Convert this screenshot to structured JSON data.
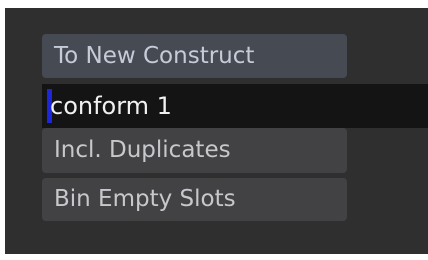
{
  "actions": {
    "to_new_construct_label": "To New Construct",
    "incl_duplicates_label": "Incl. Duplicates",
    "bin_empty_slots_label": "Bin Empty Slots"
  },
  "name_field": {
    "value": "conform 1"
  },
  "colors": {
    "panel_background": "#2f2f30",
    "button_background": "#424244",
    "primary_button_background": "#464a52",
    "field_background": "#141414",
    "caret": "#1b27d8",
    "text": "#c7c8cb",
    "field_text": "#f1f1f1"
  }
}
